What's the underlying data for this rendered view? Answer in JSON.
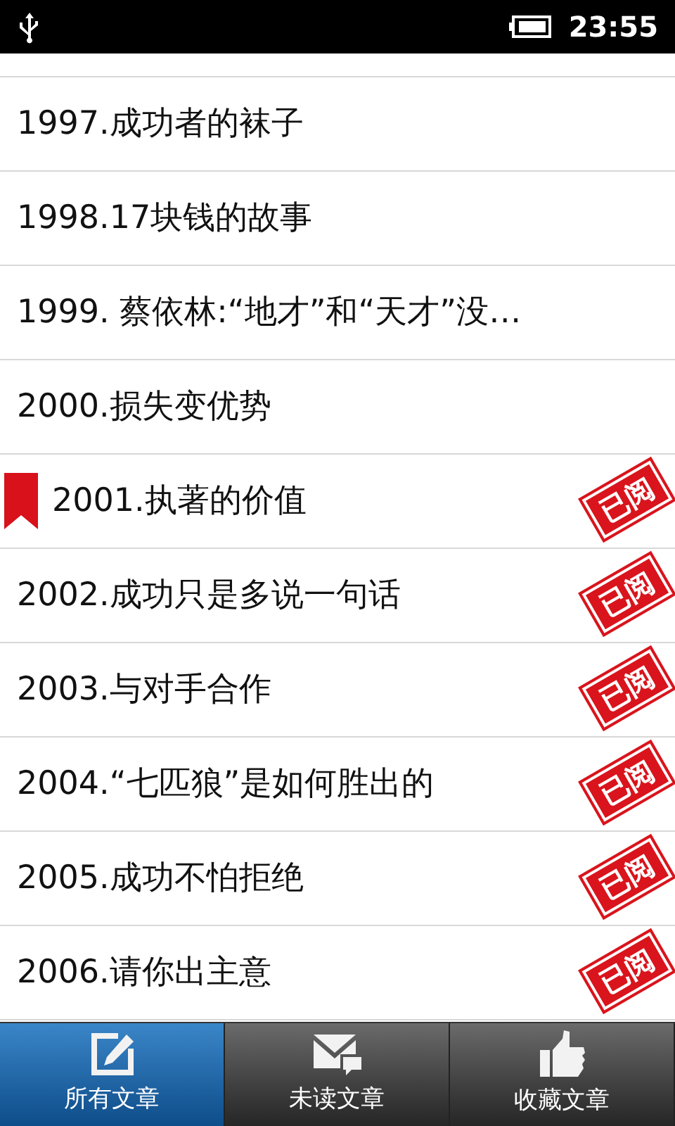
{
  "status_bar": {
    "time": "23:55"
  },
  "articles": [
    {
      "title": "1997.成功者的袜子",
      "bookmarked": false,
      "read": false
    },
    {
      "title": "1998.17块钱的故事",
      "bookmarked": false,
      "read": false
    },
    {
      "title": "1999. 蔡依林:“地才”和“天才”没…",
      "bookmarked": false,
      "read": false
    },
    {
      "title": "2000.损失变优势",
      "bookmarked": false,
      "read": false
    },
    {
      "title": "2001.执著的价值",
      "bookmarked": true,
      "read": true,
      "stamp": "已阅"
    },
    {
      "title": "2002.成功只是多说一句话",
      "bookmarked": false,
      "read": true,
      "stamp": "已阅"
    },
    {
      "title": "2003.与对手合作",
      "bookmarked": false,
      "read": true,
      "stamp": "已阅"
    },
    {
      "title": "2004.“七匹狼”是如何胜出的",
      "bookmarked": false,
      "read": true,
      "stamp": "已阅"
    },
    {
      "title": "2005.成功不怕拒绝",
      "bookmarked": false,
      "read": true,
      "stamp": "已阅"
    },
    {
      "title": "2006.请你出主意",
      "bookmarked": false,
      "read": true,
      "stamp": "已阅"
    }
  ],
  "tabs": [
    {
      "label": "所有文章",
      "kind": "compose",
      "selected": true
    },
    {
      "label": "未读文章",
      "kind": "mail",
      "selected": false
    },
    {
      "label": "收藏文章",
      "kind": "like",
      "selected": false
    }
  ]
}
